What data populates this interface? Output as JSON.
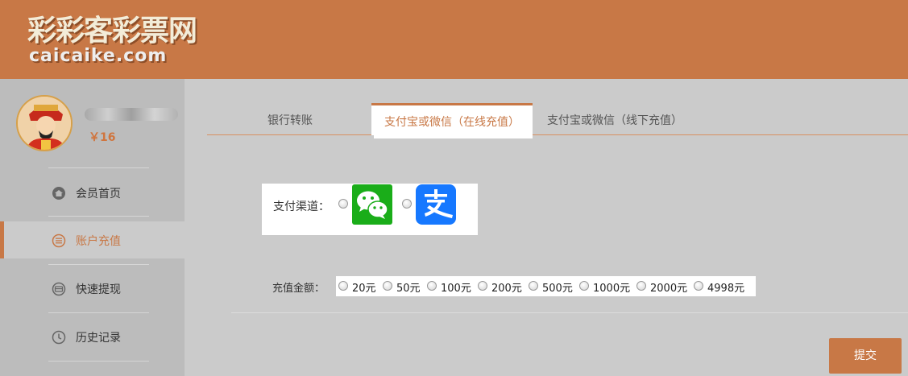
{
  "header": {
    "logo_cn": "彩彩客彩票网",
    "logo_en": "caicaike.com"
  },
  "user": {
    "balance": "￥16"
  },
  "sidebar": {
    "items": [
      {
        "label": "会员首页",
        "icon": "home-icon"
      },
      {
        "label": "账户充值",
        "icon": "recharge-icon"
      },
      {
        "label": "快速提现",
        "icon": "withdraw-icon"
      },
      {
        "label": "历史记录",
        "icon": "clock-icon"
      }
    ],
    "active_index": 1
  },
  "tabs": [
    {
      "label": "银行转账"
    },
    {
      "label": "支付宝或微信（在线充值）"
    },
    {
      "label": "支付宝或微信（线下充值）"
    }
  ],
  "active_tab": 1,
  "payment": {
    "label": "支付渠道：",
    "options": [
      "wechat-pay-icon",
      "alipay-icon"
    ]
  },
  "amount": {
    "label": "充值金额：",
    "options": [
      "20元",
      "50元",
      "100元",
      "200元",
      "500元",
      "1000元",
      "2000元",
      "4998元"
    ]
  },
  "submit_label": "提交",
  "colors": {
    "accent": "#c87846",
    "header_bg": "#c87846",
    "page_bg": "#cbcbcb",
    "sidebar_bg": "#bcbcbc",
    "wechat_green": "#1aad19",
    "alipay_blue": "#1678ff"
  }
}
